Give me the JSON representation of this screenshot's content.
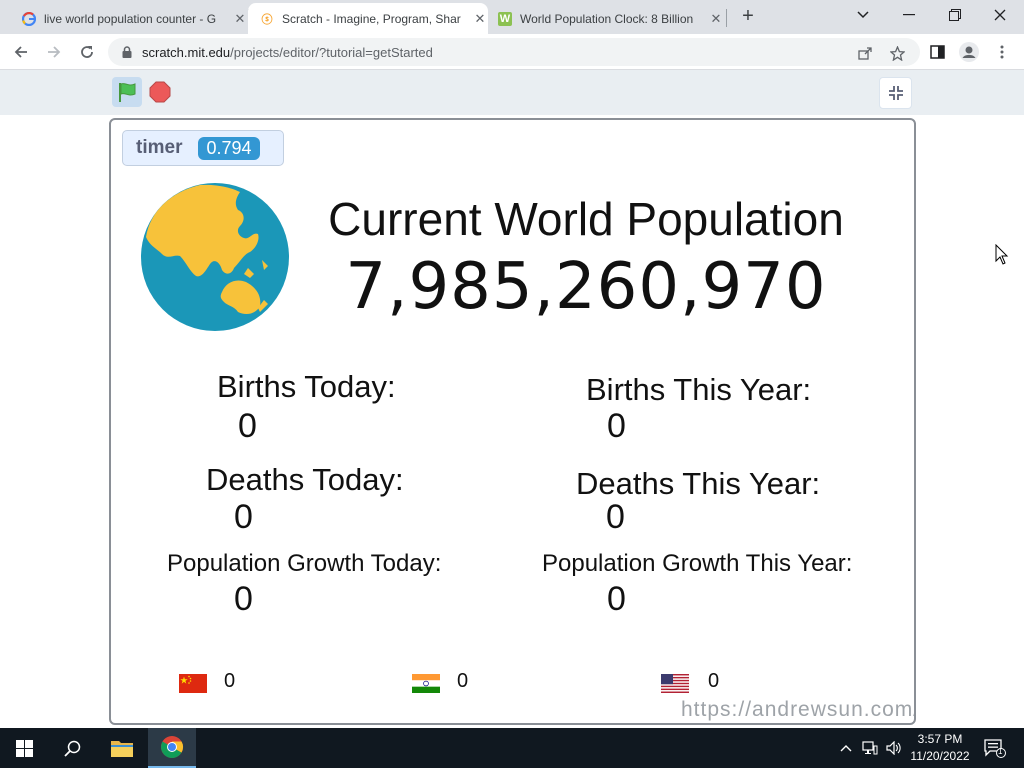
{
  "browser": {
    "tabs": [
      {
        "title": "live world population counter - G",
        "favicon": "google-icon",
        "active": false
      },
      {
        "title": "Scratch - Imagine, Program, Shar",
        "favicon": "scratch-icon",
        "active": true
      },
      {
        "title": "World Population Clock: 8 Billion",
        "favicon": "worldometers-icon",
        "active": false
      }
    ],
    "new_tab": "+",
    "url_host": "scratch.mit.edu",
    "url_path": "/projects/editor/?tutorial=getStarted"
  },
  "stage": {
    "timer_label": "timer",
    "timer_value": "0.794",
    "title": "Current World Population",
    "population": "7,985,260,970",
    "births_today_label": "Births Today:",
    "births_today_value": "0",
    "births_year_label": "Births This Year:",
    "births_year_value": "0",
    "deaths_today_label": "Deaths Today:",
    "deaths_today_value": "0",
    "deaths_year_label": "Deaths This Year:",
    "deaths_year_value": "0",
    "growth_today_label": "Population Growth Today:",
    "growth_today_value": "0",
    "growth_year_label": "Population Growth This Year:",
    "growth_year_value": "0",
    "countries": [
      {
        "flag": "china-flag-icon",
        "value": "0"
      },
      {
        "flag": "india-flag-icon",
        "value": "0"
      },
      {
        "flag": "usa-flag-icon",
        "value": "0"
      }
    ],
    "watermark": "https://andrewsun.com/"
  },
  "taskbar": {
    "time": "3:57 PM",
    "date": "11/20/2022",
    "notification_count": "1"
  },
  "colors": {
    "accent_blue": "#3397d3",
    "globe_ocean": "#1b97b8",
    "globe_land": "#f7c23a",
    "stop_red": "#ec5959",
    "flag_green": "#4cbf56"
  }
}
